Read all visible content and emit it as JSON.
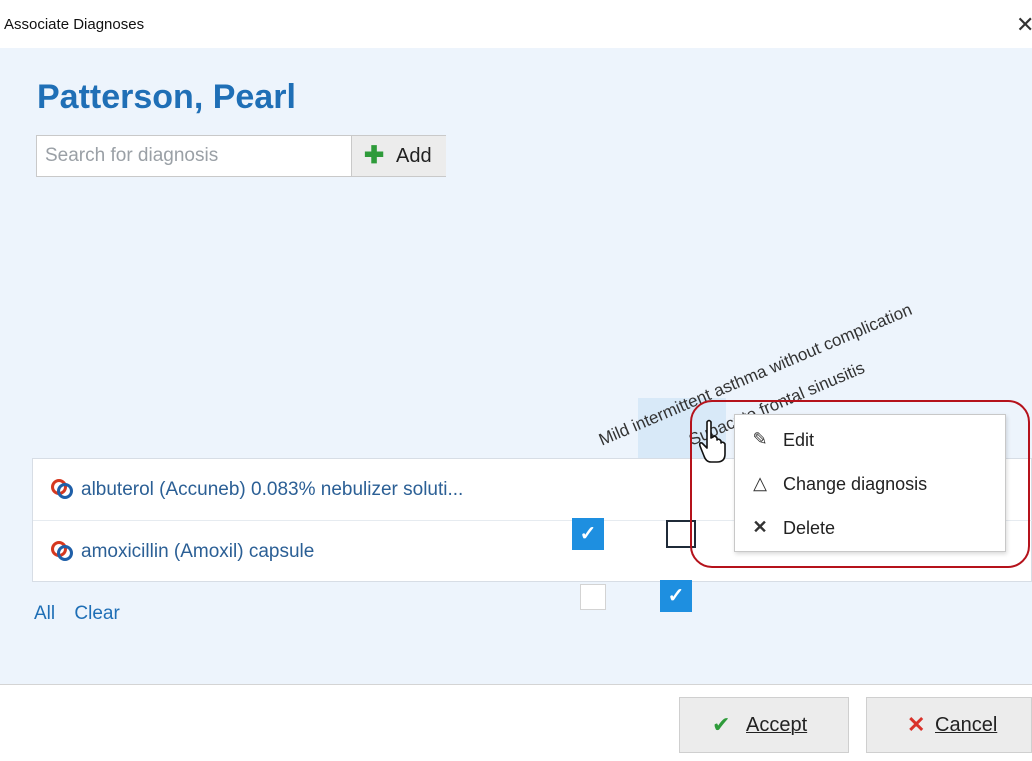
{
  "window": {
    "title": "Associate Diagnoses",
    "close_glyph": "✕"
  },
  "patient": {
    "name": "Patterson, Pearl"
  },
  "search": {
    "placeholder": "Search for diagnosis",
    "value": "",
    "add_label": "Add",
    "add_icon": "plus-icon"
  },
  "diagnoses": [
    {
      "label": "Mild intermittent asthma without complication",
      "sort_glyph": "◇"
    },
    {
      "label": "Subacute frontal sinusitis",
      "sort_glyph": "◇"
    }
  ],
  "medications": [
    {
      "name": "albuterol (Accuneb) 0.083% nebulizer soluti...",
      "icon": "rx-icon",
      "associations": [
        true,
        false
      ]
    },
    {
      "name": "amoxicillin (Amoxil) capsule",
      "icon": "rx-icon",
      "associations": [
        false,
        true
      ]
    }
  ],
  "check_glyph": "✓",
  "links": {
    "all": "All",
    "clear": "Clear"
  },
  "context_menu": {
    "items": [
      {
        "label": "Edit",
        "icon": "pencil-icon",
        "glyph": "✎"
      },
      {
        "label": "Change diagnosis",
        "icon": "triangle-icon",
        "glyph": "△"
      },
      {
        "label": "Delete",
        "icon": "x-icon",
        "glyph": "✕"
      }
    ]
  },
  "footer": {
    "accept_label": "Accept",
    "accept_glyph": "✔",
    "cancel_label": "Cancel",
    "cancel_glyph": "✕"
  },
  "colors": {
    "accent": "#1f6fb6",
    "checkbox": "#1e8fe0",
    "annotation": "#b5121b",
    "add_icon": "#2e9b3a",
    "cancel_icon": "#d9322a"
  }
}
